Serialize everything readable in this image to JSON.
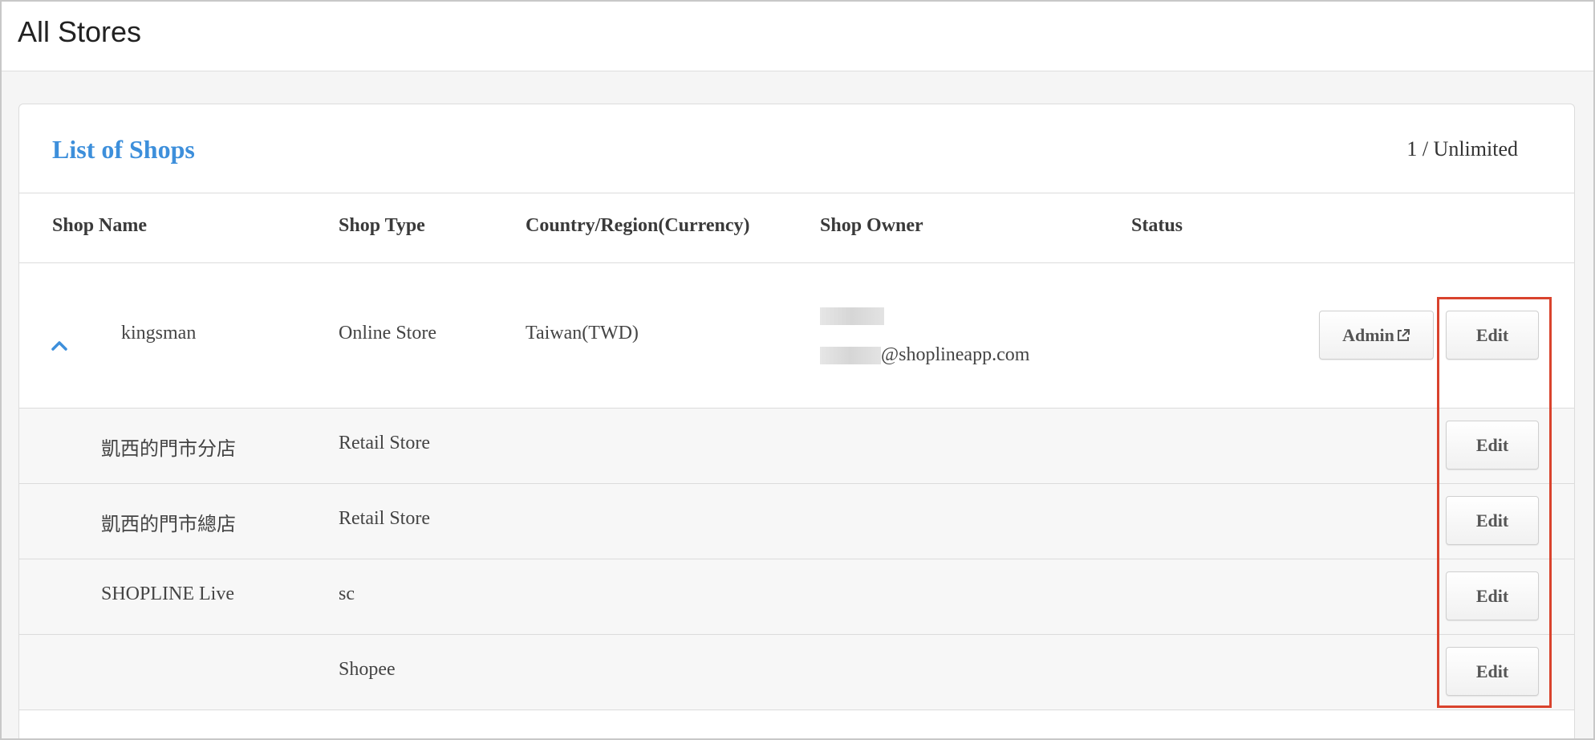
{
  "page": {
    "title": "All Stores"
  },
  "panel": {
    "title": "List of Shops",
    "count": "1 / Unlimited"
  },
  "columns": {
    "shop_name": "Shop Name",
    "shop_type": "Shop Type",
    "country": "Country/Region(Currency)",
    "owner": "Shop Owner",
    "status": "Status"
  },
  "main_shop": {
    "name": "kingsman",
    "type": "Online Store",
    "country": "Taiwan(TWD)",
    "owner_email_suffix": "@shoplineapp.com",
    "admin_label": "Admin",
    "edit_label": "Edit",
    "expand_icon": "chevron-up-icon"
  },
  "sub_shops": [
    {
      "name": "凱西的門市分店",
      "type": "Retail Store",
      "edit_label": "Edit"
    },
    {
      "name": "凱西的門市總店",
      "type": "Retail Store",
      "edit_label": "Edit"
    },
    {
      "name": "SHOPLINE Live",
      "type": "sc",
      "edit_label": "Edit"
    },
    {
      "name": "",
      "type": "Shopee",
      "edit_label": "Edit"
    }
  ],
  "colors": {
    "accent": "#3d8fdb",
    "highlight": "#d9432d"
  }
}
